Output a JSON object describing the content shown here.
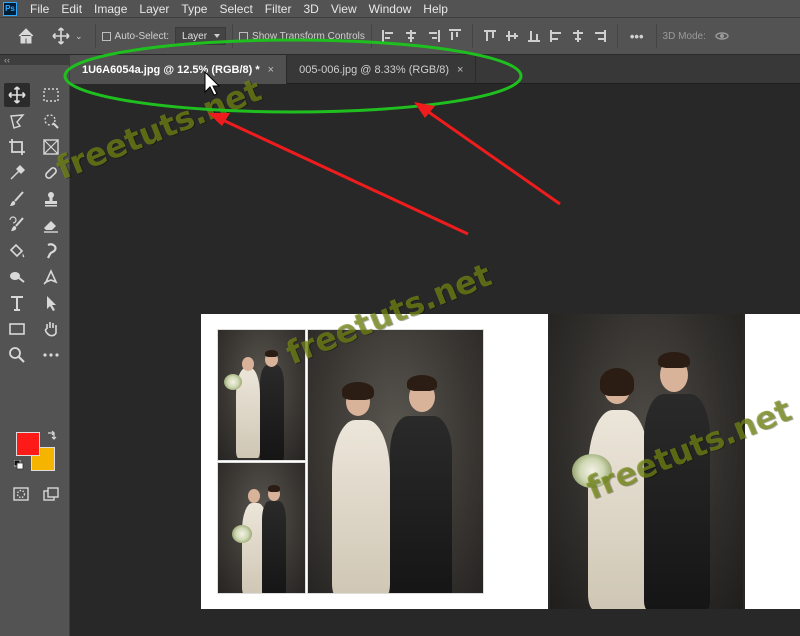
{
  "app": {
    "logo": "Ps"
  },
  "menu": [
    "File",
    "Edit",
    "Image",
    "Layer",
    "Type",
    "Select",
    "Filter",
    "3D",
    "View",
    "Window",
    "Help"
  ],
  "options": {
    "auto_select_label": "Auto-Select:",
    "layer_select_value": "Layer",
    "show_transform_label": "Show Transform Controls",
    "more_label": "•••",
    "mode_3d_label": "3D Mode:"
  },
  "tabs": [
    {
      "label": "1U6A6054a.jpg @ 12.5% (RGB/8) *",
      "close": "×",
      "active": true
    },
    {
      "label": "005-006.jpg @ 8.33% (RGB/8)",
      "close": "×",
      "active": false
    }
  ],
  "toolbar": {
    "collapse_label": "‹‹"
  },
  "colors": {
    "foreground": "#ff1a1a",
    "background": "#f4b400",
    "annotation_green": "#1fbf1f",
    "annotation_red": "#ee1c1c"
  },
  "watermark": "freetuts.net"
}
